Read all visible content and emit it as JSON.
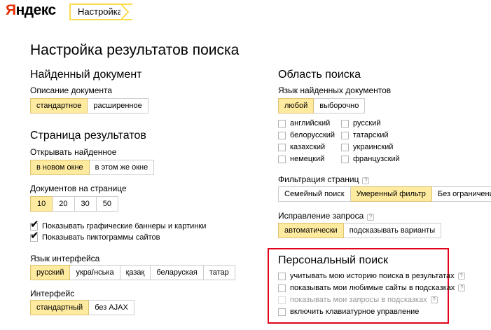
{
  "header": {
    "logo_first": "Я",
    "logo_rest": "ндекс",
    "breadcrumb": "Настройка"
  },
  "page_title": "Настройка результатов поиска",
  "found_doc": {
    "title": "Найденный документ",
    "desc_label": "Описание документа",
    "desc_options": [
      "стандартное",
      "расширенное"
    ]
  },
  "results_page": {
    "title": "Страница результатов",
    "open_label": "Открывать найденное",
    "open_options": [
      "в новом окне",
      "в этом же окне"
    ],
    "docs_label": "Документов на странице",
    "docs_options": [
      "10",
      "20",
      "30",
      "50"
    ],
    "show_banners": "Показывать графические баннеры и картинки",
    "show_icons": "Показывать пиктограммы сайтов"
  },
  "interface_lang": {
    "label": "Язык интерфейса",
    "options": [
      "русский",
      "українська",
      "қазақ",
      "беларуская",
      "татар"
    ]
  },
  "interface": {
    "label": "Интерфейс",
    "options": [
      "стандартный",
      "без AJAX"
    ]
  },
  "search_area": {
    "title": "Область поиска",
    "lang_label": "Язык найденных документов",
    "lang_options": [
      "любой",
      "выборочно"
    ],
    "langs_left": [
      "английский",
      "белорусский",
      "казахский",
      "немецкий"
    ],
    "langs_right": [
      "русский",
      "татарский",
      "украинский",
      "французский"
    ]
  },
  "filter": {
    "label": "Фильтрация страниц",
    "help": "?",
    "options": [
      "Семейный поиск",
      "Умеренный фильтр",
      "Без ограничений"
    ]
  },
  "correction": {
    "label": "Исправление запроса",
    "help": "?",
    "options": [
      "автоматически",
      "подсказывать варианты"
    ]
  },
  "personal": {
    "title": "Персональный поиск",
    "items": [
      "учитывать мою историю поиска в результатах",
      "показывать мои любимые сайты в подсказках",
      "показывать мои запросы в подсказках",
      "включить клавиатурное управление"
    ],
    "help": "?"
  }
}
